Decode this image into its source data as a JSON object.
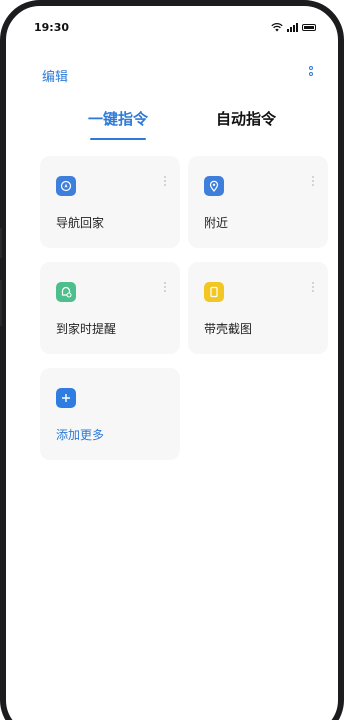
{
  "status_bar": {
    "time": "19:30",
    "icons": [
      "wifi-icon",
      "signal-icon",
      "battery-icon"
    ]
  },
  "header": {
    "edit_label": "编辑",
    "more_icon": "more-vertical-icon"
  },
  "tabs": [
    {
      "label": "一键指令",
      "active": true
    },
    {
      "label": "自动指令",
      "active": false
    }
  ],
  "cards": [
    {
      "label": "导航回家",
      "icon": "navigation-icon",
      "icon_color": "#3f7fdc"
    },
    {
      "label": "附近",
      "icon": "location-pin-icon",
      "icon_color": "#3f7fdc"
    },
    {
      "label": "到家时提醒",
      "icon": "home-bell-icon",
      "icon_color": "#4cbf8c"
    },
    {
      "label": "带壳截图",
      "icon": "phone-frame-icon",
      "icon_color": "#f2c623"
    },
    {
      "label": "添加更多",
      "icon": "plus-icon",
      "icon_color": "#2f7de1"
    }
  ],
  "colors": {
    "accent": "#2e7ad6",
    "card_bg": "#f7f7f8"
  }
}
